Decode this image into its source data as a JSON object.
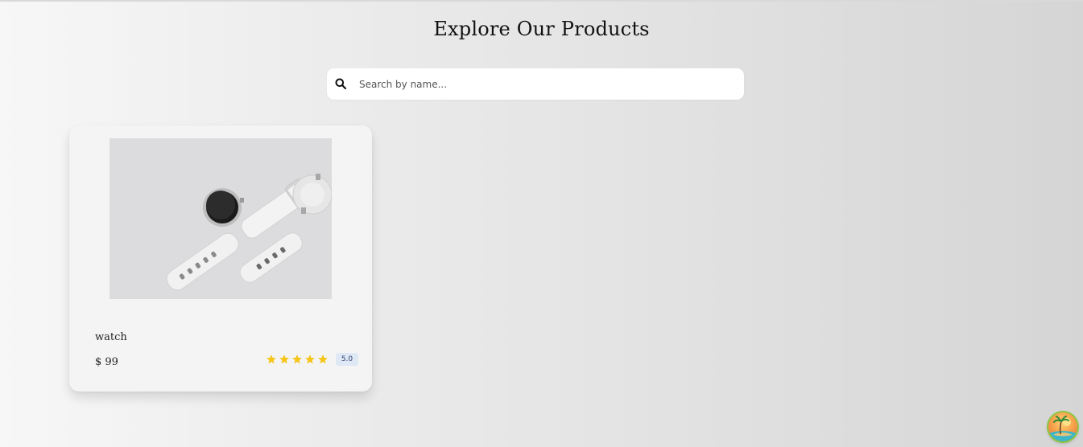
{
  "page": {
    "title": "Explore Our Products"
  },
  "search": {
    "placeholder": "Search by name...",
    "value": "",
    "icon": "search-icon"
  },
  "products": [
    {
      "name": "watch",
      "price": "$ 99",
      "rating": 5,
      "rating_label": "5.0",
      "image": "smartwatch-photo"
    }
  ],
  "colors": {
    "star": "#f5c518",
    "badge_bg": "#dfe9f5",
    "badge_text": "#2c3e6b"
  },
  "floating_button": {
    "icon": "island-avatar-icon"
  }
}
